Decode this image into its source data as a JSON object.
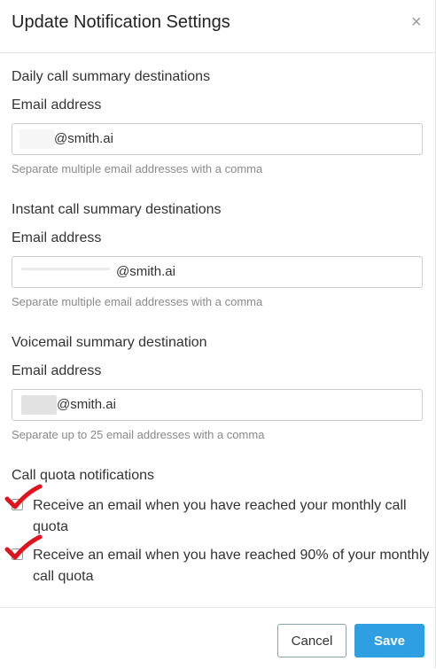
{
  "modal": {
    "title": "Update Notification Settings",
    "close_glyph": "×"
  },
  "daily": {
    "section_label": "Daily call summary destinations",
    "field_label": "Email address",
    "value": "@smith.ai",
    "help": "Separate multiple email addresses with a comma"
  },
  "instant": {
    "section_label": "Instant call summary destinations",
    "field_label": "Email address",
    "value": "@smith.ai",
    "help": "Separate multiple email addresses with a comma"
  },
  "voicemail": {
    "section_label": "Voicemail summary destination",
    "field_label": "Email address",
    "value": "@smith.ai",
    "help": "Separate up to 25 email addresses with a comma"
  },
  "quota": {
    "section_label": "Call quota notifications",
    "options": [
      {
        "label": "Receive an email when you have reached your monthly call quota",
        "checked": false
      },
      {
        "label": "Receive an email when you have reached 90% of your monthly call quota",
        "checked": false
      }
    ]
  },
  "footer": {
    "cancel_label": "Cancel",
    "save_label": "Save"
  },
  "colors": {
    "primary": "#2e9fe0",
    "annotation_check": "#e0141e",
    "help_text": "#8a8a8a"
  }
}
